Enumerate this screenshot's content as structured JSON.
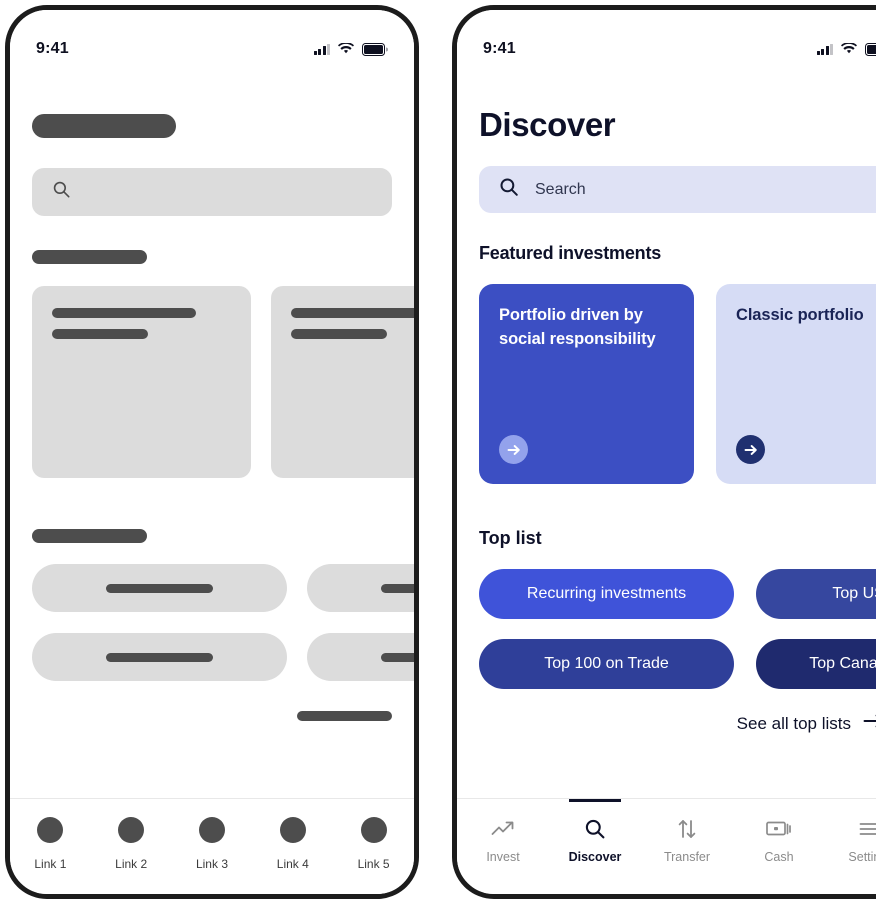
{
  "colors": {
    "brand_blue": "#3c4fc3",
    "pill_bright": "#3f53d9",
    "pill_mid": "#2f3f99",
    "pill_dark": "#1f2a6e",
    "card_lavender": "#d6dcf5",
    "search_lavender": "#dfe2f5",
    "navy_text": "#1a2456",
    "skeleton_bar": "#4d4d4d",
    "skeleton_box": "#dcdcdc",
    "ink": "#0e1129"
  },
  "skeleton_phone": {
    "status": {
      "time": "9:41",
      "cellular_icon": "signal-bars-icon",
      "wifi_icon": "wifi-icon",
      "battery_icon": "battery-icon"
    },
    "search_icon": "search-icon",
    "tabs": [
      {
        "label": "Link 1",
        "icon": "dot-icon"
      },
      {
        "label": "Link 2",
        "icon": "dot-icon"
      },
      {
        "label": "Link 3",
        "icon": "dot-icon"
      },
      {
        "label": "Link 4",
        "icon": "dot-icon"
      },
      {
        "label": "Link 5",
        "icon": "dot-icon"
      }
    ]
  },
  "discover_phone": {
    "status": {
      "time": "9:41",
      "cellular_icon": "signal-bars-icon",
      "wifi_icon": "wifi-icon",
      "battery_icon": "battery-icon"
    },
    "title": "Discover",
    "search": {
      "placeholder": "Search",
      "value": "",
      "icon": "search-icon"
    },
    "featured": {
      "heading": "Featured investments",
      "cards": [
        {
          "title": "Portfolio driven by social responsibility",
          "bg": "#3c4fc3",
          "text_color": "#ffffff",
          "arrow_bg": "#93a2ec",
          "arrow_color": "#ffffff",
          "arrow_icon": "arrow-right-circle-icon"
        },
        {
          "title": "Classic portfolio",
          "bg": "#d6dcf5",
          "text_color": "#1a2456",
          "arrow_bg": "#203070",
          "arrow_color": "#ffffff",
          "arrow_icon": "arrow-right-circle-icon"
        }
      ]
    },
    "top_list": {
      "heading": "Top list",
      "pills": [
        {
          "label": "Recurring investments",
          "bg": "#3f53d9"
        },
        {
          "label": "Top US stocks",
          "bg": "#36479f"
        },
        {
          "label": "Top 100 on Trade",
          "bg": "#2f3f99"
        },
        {
          "label": "Top Canadian stocks",
          "bg": "#1f2a6e"
        }
      ],
      "see_all": {
        "label": "See all top lists",
        "icon": "arrow-right-icon"
      }
    },
    "tabs": [
      {
        "label": "Invest",
        "icon": "trend-up-icon",
        "active": false
      },
      {
        "label": "Discover",
        "icon": "search-icon",
        "active": true
      },
      {
        "label": "Transfer",
        "icon": "transfer-arrows-icon",
        "active": false
      },
      {
        "label": "Cash",
        "icon": "banknote-icon",
        "active": false
      },
      {
        "label": "Settings",
        "icon": "hamburger-menu-icon",
        "active": false
      }
    ]
  }
}
